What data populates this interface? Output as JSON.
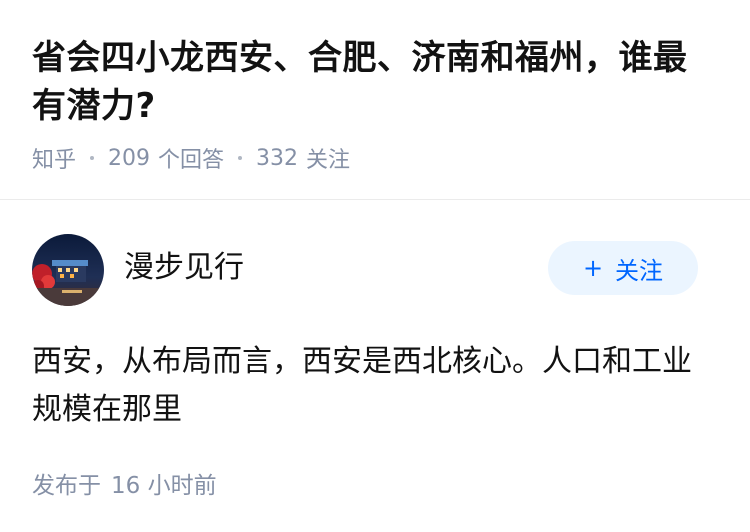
{
  "question": {
    "title": "省会四小龙西安、合肥、济南和福州，谁最有潜力?",
    "source": "知乎",
    "answer_count": "209",
    "answer_label": "个回答",
    "follow_count": "332",
    "follow_label": "关注"
  },
  "answer": {
    "author_name": "漫步见行",
    "follow_button": "关注",
    "content": "西安，从布局而言，西安是西北核心。人口和工业规模在那里",
    "publish_label": "发布于",
    "publish_time": "16 小时前"
  },
  "colors": {
    "accent": "#0066ff",
    "follow_bg": "#ebf5ff",
    "meta_text": "#8590a6",
    "primary_text": "#121212"
  }
}
